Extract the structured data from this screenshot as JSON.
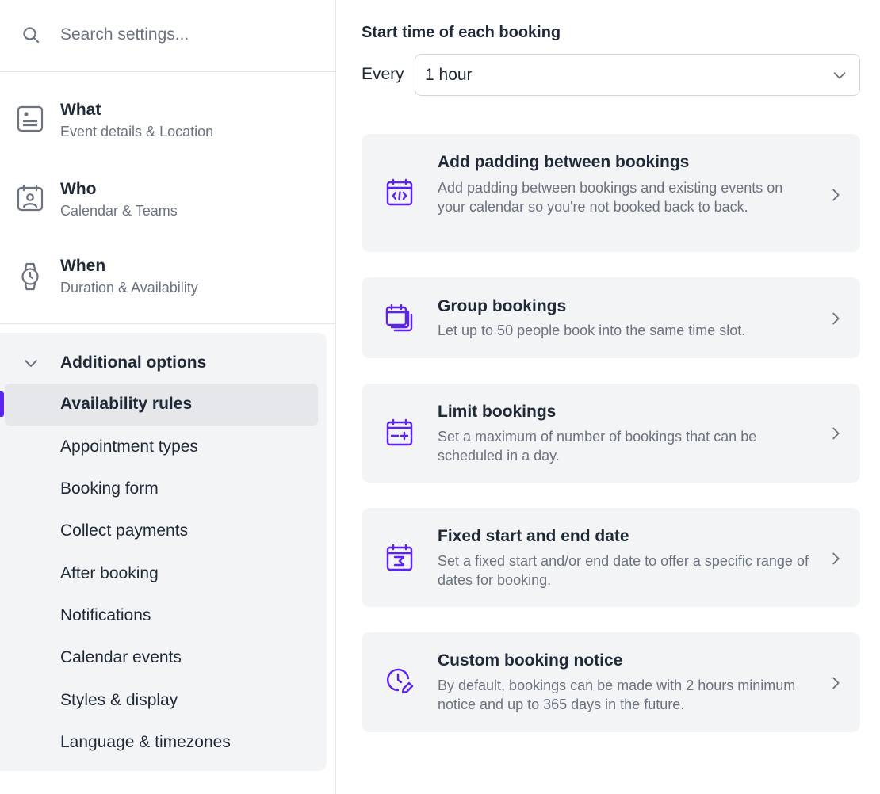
{
  "colors": {
    "accent": "#5b21f5",
    "border": "#e5e7eb",
    "panel": "#f3f4f6",
    "muted": "#6b7280",
    "text": "#1f2937"
  },
  "search": {
    "placeholder": "Search settings...",
    "value": ""
  },
  "sidebar": {
    "primary": [
      {
        "title": "What",
        "subtitle": "Event details & Location",
        "icon": "document-icon"
      },
      {
        "title": "Who",
        "subtitle": "Calendar & Teams",
        "icon": "user-calendar-icon"
      },
      {
        "title": "When",
        "subtitle": "Duration & Availability",
        "icon": "watch-icon"
      }
    ],
    "additional": {
      "label": "Additional options",
      "items": [
        {
          "label": "Availability rules",
          "active": true
        },
        {
          "label": "Appointment types"
        },
        {
          "label": "Booking form"
        },
        {
          "label": "Collect payments"
        },
        {
          "label": "After booking"
        },
        {
          "label": "Notifications"
        },
        {
          "label": "Calendar events"
        },
        {
          "label": "Styles & display"
        },
        {
          "label": "Language & timezones"
        }
      ]
    }
  },
  "main": {
    "start_time": {
      "title": "Start time of each booking",
      "every_label": "Every",
      "selected": "1 hour"
    },
    "cards": [
      {
        "title": "Add padding between bookings",
        "desc": "Add padding between bookings and existing events on your calendar so you're not booked back to back.",
        "icon": "calendar-code-icon"
      },
      {
        "title": "Group bookings",
        "desc": "Let up to 50 people book into the same time slot.",
        "icon": "stacked-calendars-icon"
      },
      {
        "title": "Limit bookings",
        "desc": "Set a maximum of number of bookings that can be scheduled in a day.",
        "icon": "calendar-plus-icon"
      },
      {
        "title": "Fixed start and end date",
        "desc": "Set a fixed start and/or end date to offer a specific range of dates for booking.",
        "icon": "calendar-range-icon"
      },
      {
        "title": "Custom booking notice",
        "desc": "By default, bookings can be made with 2 hours minimum notice and up to 365 days in the future.",
        "icon": "clock-edit-icon"
      }
    ]
  }
}
